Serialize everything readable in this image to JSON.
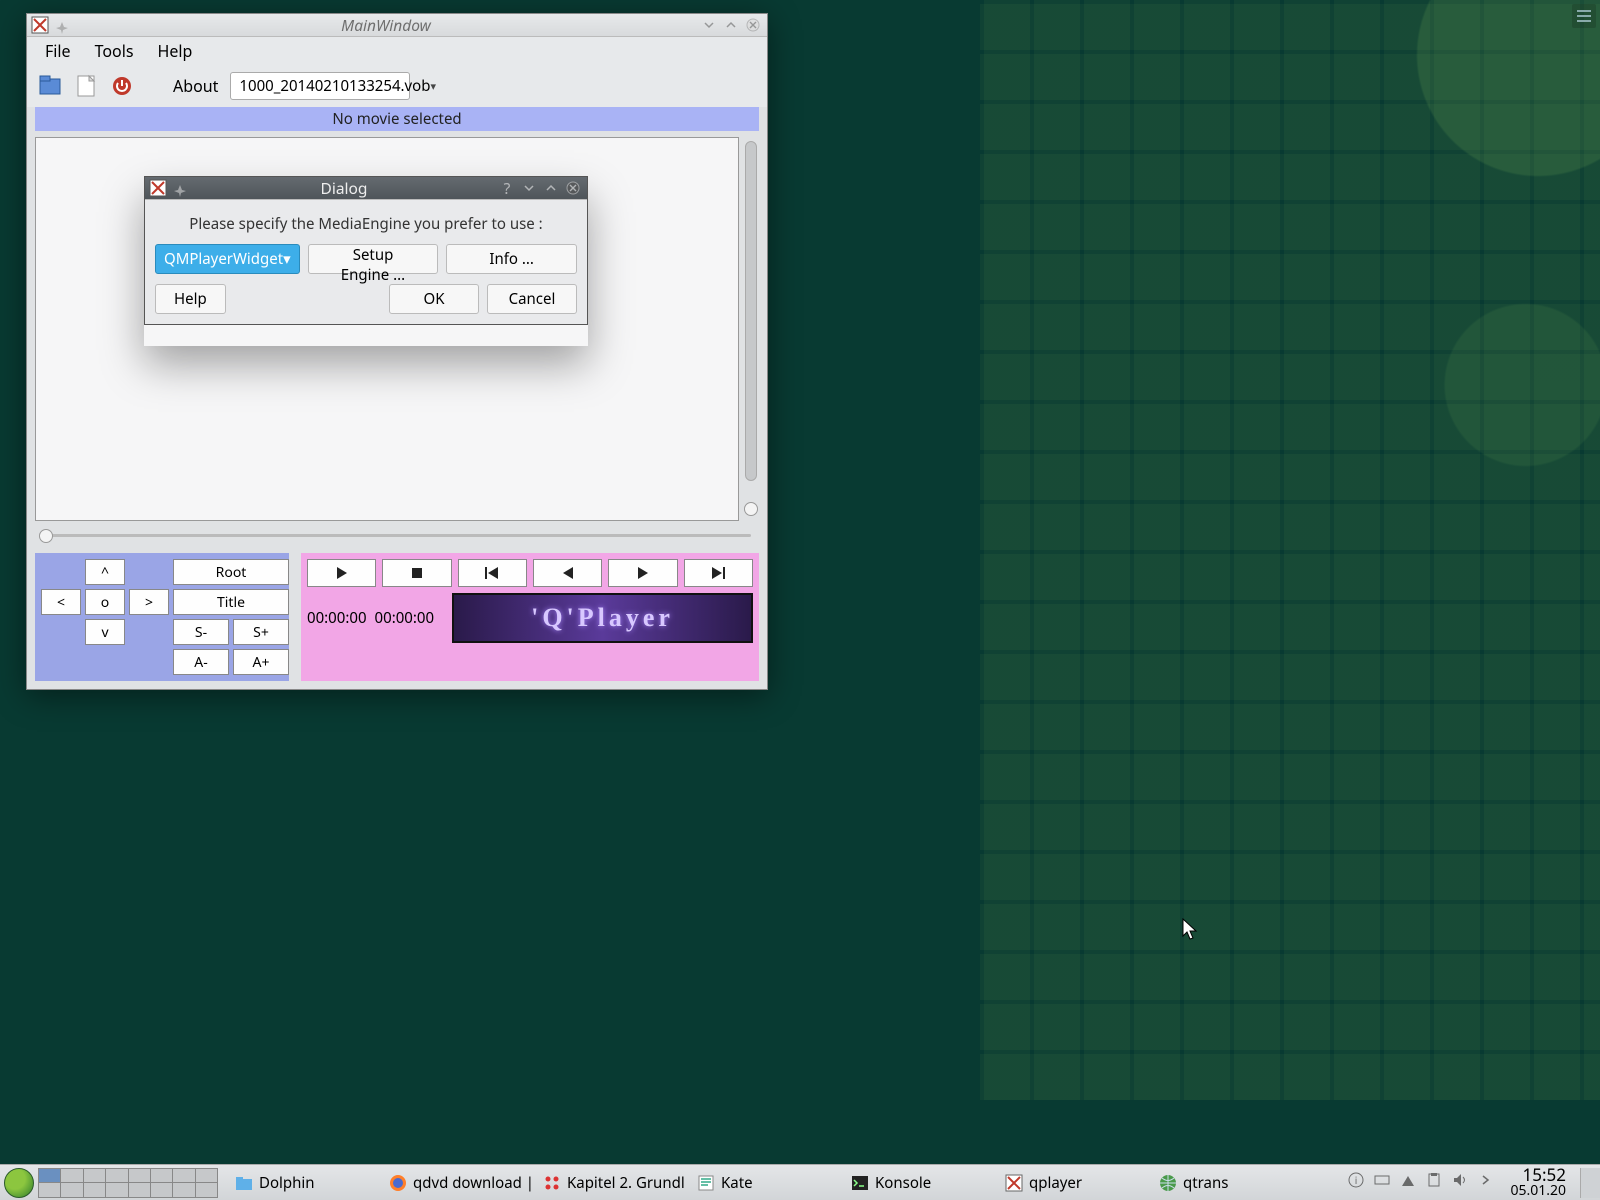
{
  "main_window": {
    "title": "MainWindow",
    "menubar": {
      "file": "File",
      "tools": "Tools",
      "help": "Help"
    },
    "toolbar": {
      "about_label": "About",
      "file_combo_value": "1000_20140210133254.vob"
    },
    "banner_text": "No movie selected",
    "nav_pad": {
      "up": "^",
      "down": "v",
      "left": "<",
      "right": ">",
      "center": "o",
      "root": "Root",
      "title": "Title",
      "s_minus": "S-",
      "s_plus": "S+",
      "a_minus": "A-",
      "a_plus": "A+"
    },
    "play_panel": {
      "time_current": "00:00:00",
      "time_total": "00:00:00",
      "logo_text": "'Q'Player"
    }
  },
  "dialog": {
    "title": "Dialog",
    "message": "Please specify the MediaEngine you prefer to use :",
    "engine_value": "QMPlayerWidget",
    "setup_btn": "Setup Engine ...",
    "info_btn": "Info ...",
    "help_btn": "Help",
    "ok_btn": "OK",
    "cancel_btn": "Cancel"
  },
  "taskbar": {
    "items": [
      {
        "label": "Dolphin",
        "icon": "folder-icon"
      },
      {
        "label": "qdvd download | ...",
        "icon": "firefox-icon"
      },
      {
        "label": "Kapitel 2. Grundl...",
        "icon": "dots-icon"
      },
      {
        "label": "Kate",
        "icon": "kate-icon"
      },
      {
        "label": "Konsole",
        "icon": "terminal-icon"
      },
      {
        "label": "qplayer",
        "icon": "x-icon"
      },
      {
        "label": "qtrans",
        "icon": "globe-icon"
      }
    ],
    "clock_time": "15:52",
    "clock_date": "05.01.20"
  }
}
